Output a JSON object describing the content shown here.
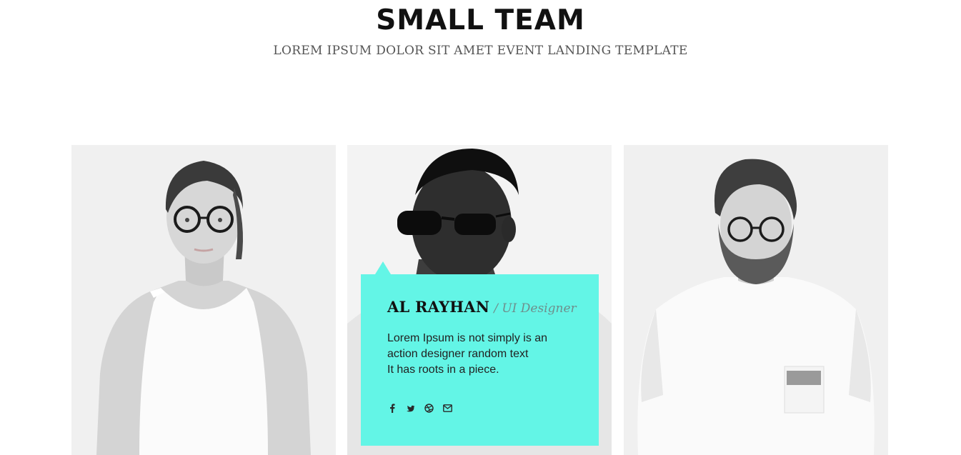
{
  "section": {
    "title": "SMALL TEAM",
    "subtitle": "LOREM IPSUM DOLOR SIT AMET EVENT LANDING TEMPLATE"
  },
  "team": {
    "members": [
      {
        "photo": "woman-with-glasses-photo"
      },
      {
        "photo": "man-with-sunglasses-photo",
        "name": "AL RAYHAN",
        "role": "/ UI Designer",
        "bio": [
          "Lorem Ipsum is not simply is an",
          "action designer random text",
          "It has roots in a piece."
        ],
        "social": [
          "facebook-icon",
          "twitter-icon",
          "dribbble-icon",
          "envelope-icon"
        ]
      },
      {
        "photo": "bearded-man-with-glasses-photo"
      }
    ]
  },
  "colors": {
    "accent": "#63f5e6",
    "heading": "#111111",
    "subtitle": "#555555",
    "card_bg": "#f1f1f1"
  }
}
